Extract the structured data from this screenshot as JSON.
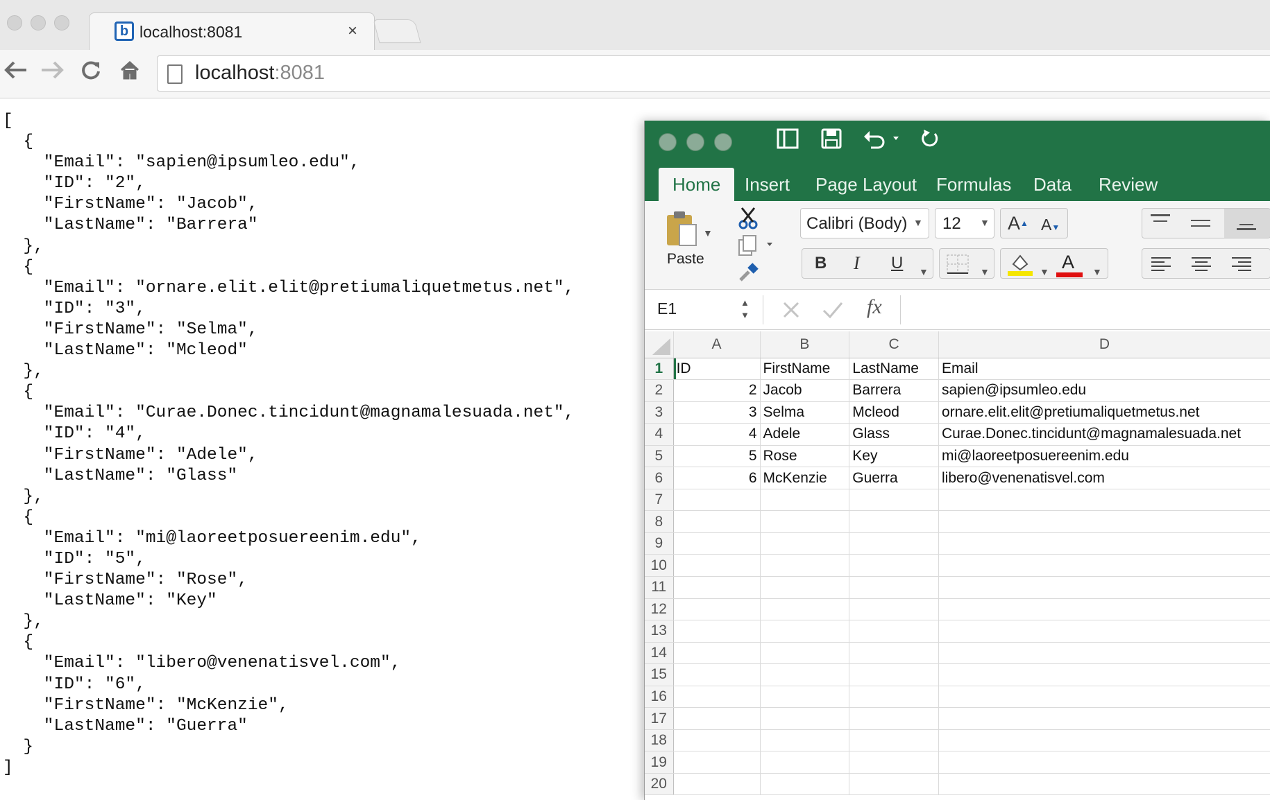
{
  "browser": {
    "tab_title": "localhost:8081",
    "tab_favicon": "b",
    "close_glyph": "×",
    "url_host": "localhost",
    "url_port": ":8081"
  },
  "json_text": "[\n  {\n    \"Email\": \"sapien@ipsumleo.edu\",\n    \"ID\": \"2\",\n    \"FirstName\": \"Jacob\",\n    \"LastName\": \"Barrera\"\n  },\n  {\n    \"Email\": \"ornare.elit.elit@pretiumaliquetmetus.net\",\n    \"ID\": \"3\",\n    \"FirstName\": \"Selma\",\n    \"LastName\": \"Mcleod\"\n  },\n  {\n    \"Email\": \"Curae.Donec.tincidunt@magnamalesuada.net\",\n    \"ID\": \"4\",\n    \"FirstName\": \"Adele\",\n    \"LastName\": \"Glass\"\n  },\n  {\n    \"Email\": \"mi@laoreetposuereenim.edu\",\n    \"ID\": \"5\",\n    \"FirstName\": \"Rose\",\n    \"LastName\": \"Key\"\n  },\n  {\n    \"Email\": \"libero@venenatisvel.com\",\n    \"ID\": \"6\",\n    \"FirstName\": \"McKenzie\",\n    \"LastName\": \"Guerra\"\n  }\n]",
  "excel": {
    "tabs": [
      "Home",
      "Insert",
      "Page Layout",
      "Formulas",
      "Data",
      "Review"
    ],
    "paste_label": "Paste",
    "font_name": "Calibri (Body)",
    "font_size": "12",
    "bold": "B",
    "italic": "I",
    "underline": "U",
    "grow_font": "A",
    "shrink_font": "A",
    "font_color_letter": "A",
    "namebox": "E1",
    "fx": "fx",
    "columns": [
      "A",
      "B",
      "C",
      "D"
    ],
    "rows": [
      [
        "ID",
        "FirstName",
        "LastName",
        "Email"
      ],
      [
        "2",
        "Jacob",
        "Barrera",
        "sapien@ipsumleo.edu"
      ],
      [
        "3",
        "Selma",
        "Mcleod",
        "ornare.elit.elit@pretiumaliquetmetus.net"
      ],
      [
        "4",
        "Adele",
        "Glass",
        "Curae.Donec.tincidunt@magnamalesuada.net"
      ],
      [
        "5",
        "Rose",
        "Key",
        "mi@laoreetposuereenim.edu"
      ],
      [
        "6",
        "McKenzie",
        "Guerra",
        "libero@venenatisvel.com"
      ]
    ],
    "row_numbers": [
      "1",
      "2",
      "3",
      "4",
      "5",
      "6",
      "7",
      "8",
      "9",
      "10",
      "11",
      "12",
      "13",
      "14",
      "15",
      "16",
      "17",
      "18",
      "19",
      "20"
    ],
    "accent_color": "#217346"
  }
}
